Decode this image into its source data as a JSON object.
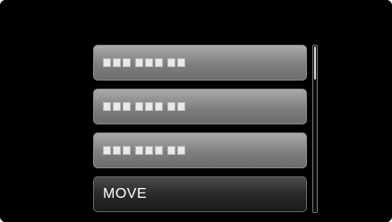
{
  "menu": {
    "items": [
      {
        "label": "",
        "blurred": true,
        "selected": false
      },
      {
        "label": "",
        "blurred": true,
        "selected": false
      },
      {
        "label": "",
        "blurred": true,
        "selected": false
      },
      {
        "label": "MOVE",
        "blurred": false,
        "selected": true
      }
    ]
  },
  "scrollbar": {
    "thumb_fraction": 0.2,
    "thumb_position": 0.0
  },
  "colors": {
    "background": "#000000",
    "item_fill": "#8a8a8a",
    "selected_fill": "#2a2a2a",
    "text": "#ffffff"
  }
}
